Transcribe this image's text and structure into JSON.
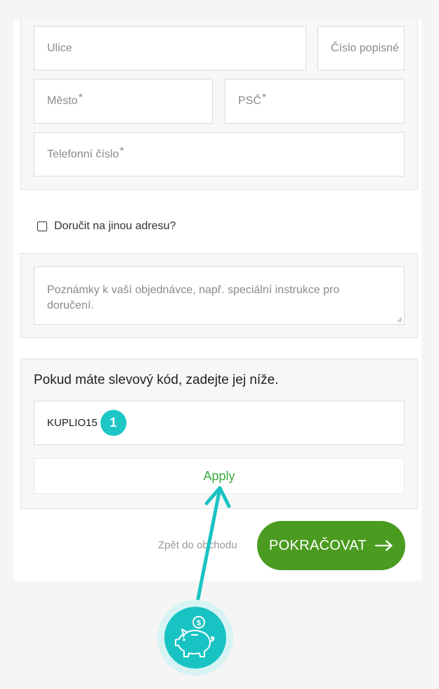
{
  "address": {
    "street_placeholder": "Ulice",
    "house_number_placeholder": "Číslo popisné",
    "city_placeholder": "Město",
    "zip_placeholder": "PSČ",
    "phone_placeholder": "Telefonní číslo",
    "required_mark": "*"
  },
  "shipping": {
    "different_address_label": "Doručit na jinou adresu?"
  },
  "notes": {
    "placeholder": "Poznámky k vaší objednávce, např. speciální instrukce pro doručení."
  },
  "coupon": {
    "title": "Pokud máte slevový kód, zadejte jej níže.",
    "code_value": "KUPLIO15",
    "step_badge": "1",
    "apply_label": "Apply"
  },
  "actions": {
    "back_label": "Zpět do obchodu",
    "continue_label": "POKRAČOVAT"
  },
  "icons": {
    "arrow": "arrow-right-icon",
    "piggy": "piggy-bank-icon",
    "coin": "dollar-coin-icon"
  },
  "colors": {
    "continue_button": "#4a9b1f",
    "apply_text": "#3daa3d",
    "accent_teal": "#19c3c3"
  }
}
